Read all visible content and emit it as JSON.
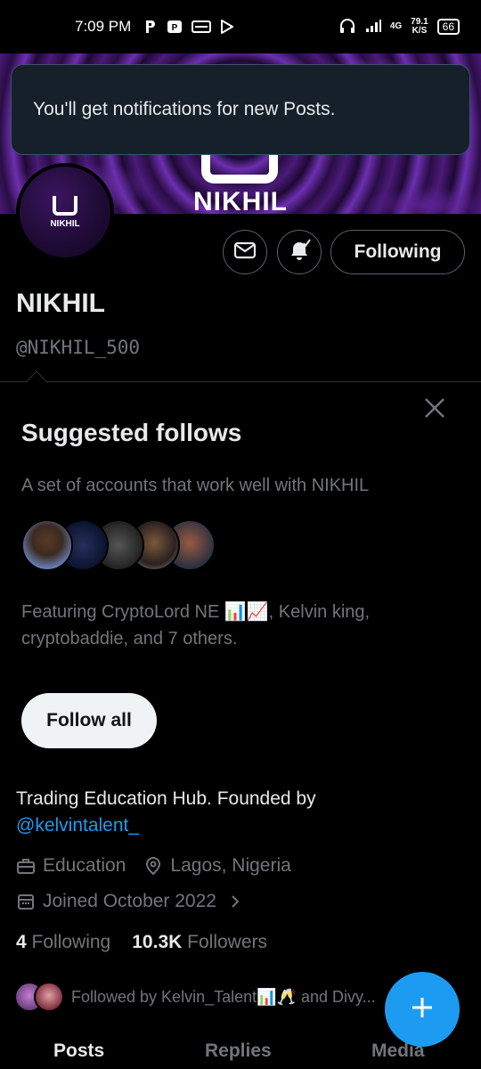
{
  "status_bar": {
    "time": "7:09 PM",
    "network": "4G",
    "speed_value": "79.1",
    "speed_unit": "K/S",
    "battery": "66"
  },
  "toast": {
    "text": "You'll get notifications for new Posts."
  },
  "banner": {
    "name": "NIKHIL"
  },
  "avatar": {
    "name": "NIKHIL"
  },
  "profile": {
    "following_button": "Following",
    "name": "NIKHIL",
    "handle": "@NIKHIL_500"
  },
  "suggested": {
    "title": "Suggested follows",
    "subtitle": "A set of accounts that work well with NIKHIL",
    "featuring": "Featuring CryptoLord NE 📊📈, Kelvin king, cryptobaddie, and 7 others.",
    "follow_all": "Follow all"
  },
  "bio": {
    "text": "Trading Education Hub.  Founded by",
    "mention": "@kelvintalent_"
  },
  "meta": {
    "category": "Education",
    "location": "Lagos, Nigeria",
    "joined": "Joined October 2022"
  },
  "counts": {
    "following_count": "4",
    "following_label": "Following",
    "followers_count": "10.3K",
    "followers_label": "Followers"
  },
  "followed_by": {
    "text": "Followed by Kelvin_Talent📊🥂 and Divy..."
  },
  "tabs": [
    "Posts",
    "Replies",
    "Media"
  ],
  "colors": {
    "accent": "#1d9bf0",
    "background": "#000000",
    "muted": "#71767b"
  }
}
